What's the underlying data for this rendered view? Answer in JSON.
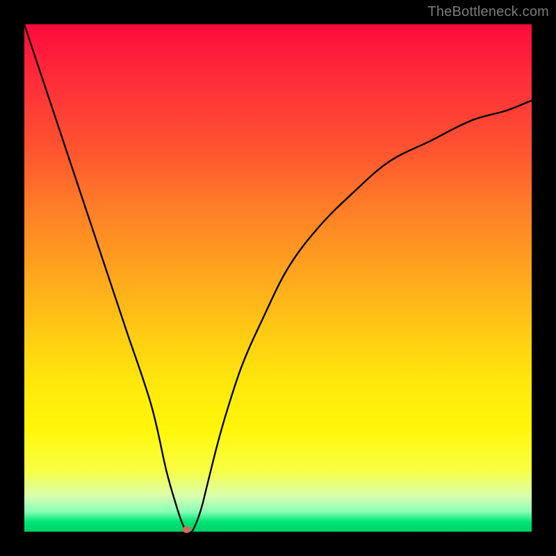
{
  "watermark": "TheBottleneck.com",
  "chart_data": {
    "type": "line",
    "title": "",
    "xlabel": "",
    "ylabel": "",
    "xlim": [
      0,
      100
    ],
    "ylim": [
      0,
      100
    ],
    "background_gradient": {
      "top": "#ff0a3c",
      "mid": "#ffe60c",
      "bottom": "#00d068"
    },
    "series": [
      {
        "name": "bottleneck-curve",
        "x": [
          0,
          5,
          10,
          15,
          20,
          25,
          28,
          30,
          31,
          32,
          33,
          34,
          35,
          36,
          38,
          40,
          43,
          47,
          52,
          58,
          65,
          72,
          80,
          88,
          95,
          100
        ],
        "y": [
          100,
          85,
          70,
          55,
          40,
          25,
          12,
          5,
          2,
          0,
          0,
          2,
          5,
          9,
          17,
          24,
          33,
          42,
          52,
          60,
          67,
          73,
          77,
          81,
          83,
          85
        ]
      }
    ],
    "marker": {
      "x": 32,
      "y": 0,
      "color": "#d46a5f"
    }
  }
}
